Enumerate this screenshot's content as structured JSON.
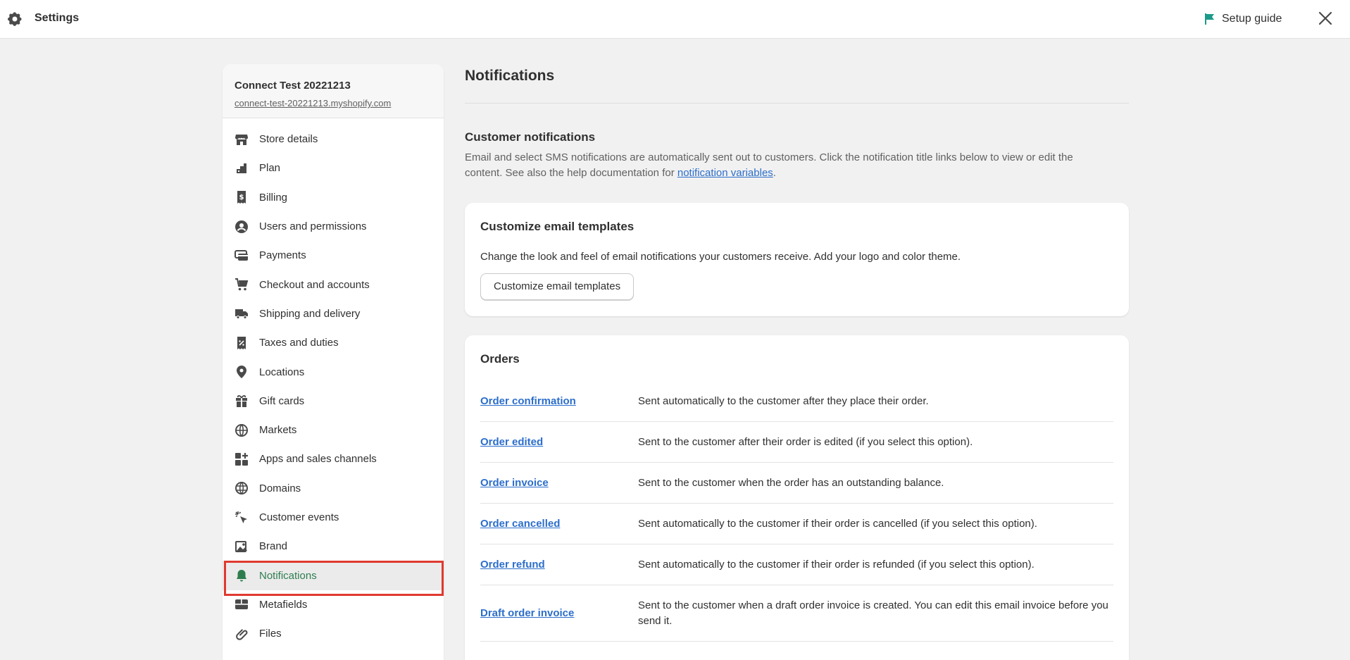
{
  "topbar": {
    "title": "Settings",
    "setup_guide": "Setup guide"
  },
  "store": {
    "name": "Connect Test 20221213",
    "url": "connect-test-20221213.myshopify.com"
  },
  "nav": [
    {
      "label": "Store details",
      "icon": "store-icon"
    },
    {
      "label": "Plan",
      "icon": "plan-icon"
    },
    {
      "label": "Billing",
      "icon": "billing-icon"
    },
    {
      "label": "Users and permissions",
      "icon": "user-icon"
    },
    {
      "label": "Payments",
      "icon": "payments-icon"
    },
    {
      "label": "Checkout and accounts",
      "icon": "cart-icon"
    },
    {
      "label": "Shipping and delivery",
      "icon": "truck-icon"
    },
    {
      "label": "Taxes and duties",
      "icon": "tax-icon"
    },
    {
      "label": "Locations",
      "icon": "location-pin-icon"
    },
    {
      "label": "Gift cards",
      "icon": "gift-icon"
    },
    {
      "label": "Markets",
      "icon": "globe-markets-icon"
    },
    {
      "label": "Apps and sales channels",
      "icon": "apps-icon"
    },
    {
      "label": "Domains",
      "icon": "globe-icon"
    },
    {
      "label": "Customer events",
      "icon": "cursor-click-icon"
    },
    {
      "label": "Brand",
      "icon": "brand-icon"
    },
    {
      "label": "Notifications",
      "icon": "bell-icon",
      "active": true
    },
    {
      "label": "Metafields",
      "icon": "metafields-icon"
    },
    {
      "label": "Files",
      "icon": "paperclip-icon"
    }
  ],
  "main": {
    "title": "Notifications",
    "customer": {
      "title": "Customer notifications",
      "desc_before": "Email and select SMS notifications are automatically sent out to customers. Click the notification title links below to view or edit the content. See also the help documentation for ",
      "desc_link": "notification variables",
      "desc_after": "."
    },
    "templates_card": {
      "title": "Customize email templates",
      "text": "Change the look and feel of email notifications your customers receive. Add your logo and color theme.",
      "button": "Customize email templates"
    },
    "orders_card": {
      "title": "Orders",
      "rows": [
        {
          "name": "Order confirmation",
          "desc": "Sent automatically to the customer after they place their order."
        },
        {
          "name": "Order edited",
          "desc": "Sent to the customer after their order is edited (if you select this option)."
        },
        {
          "name": "Order invoice",
          "desc": "Sent to the customer when the order has an outstanding balance."
        },
        {
          "name": "Order cancelled",
          "desc": "Sent automatically to the customer if their order is cancelled (if you select this option)."
        },
        {
          "name": "Order refund",
          "desc": "Sent automatically to the customer if their order is refunded (if you select this option)."
        },
        {
          "name": "Draft order invoice",
          "desc": "Sent to the customer when a draft order invoice is created. You can edit this email invoice before you send it."
        }
      ]
    }
  },
  "colors": {
    "accent_green": "#2f7d4f",
    "link_blue": "#2c6ecb",
    "highlight_red": "#e03a2f",
    "setup_flag": "#1a9a8a"
  }
}
